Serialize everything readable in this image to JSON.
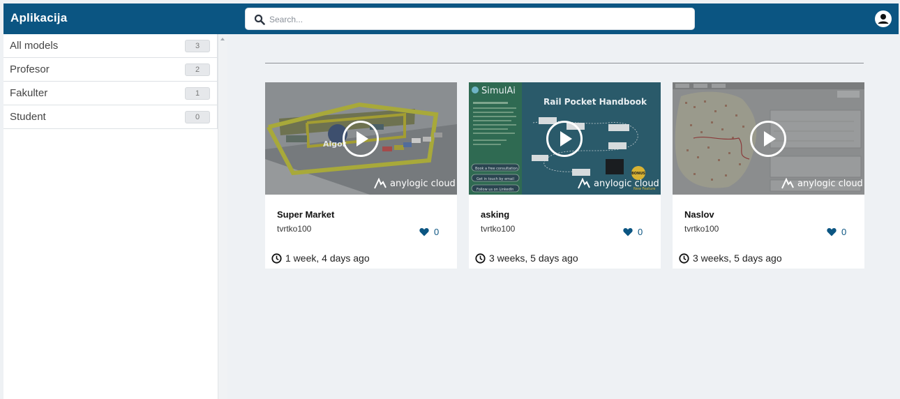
{
  "app": {
    "title": "Aplikacija"
  },
  "search": {
    "placeholder": "Search..."
  },
  "sidebar": {
    "items": [
      {
        "label": "All models",
        "count": "3"
      },
      {
        "label": "Profesor",
        "count": "2"
      },
      {
        "label": "Fakulter",
        "count": "1"
      },
      {
        "label": "Student",
        "count": "0"
      }
    ]
  },
  "models": [
    {
      "title": "Super Market",
      "author": "tvrtko100",
      "likes": "0",
      "time": "1 week, 4 days ago",
      "brand": "anylogic cloud",
      "thumb_text": [
        "Algor"
      ]
    },
    {
      "title": "asking",
      "author": "tvrtko100",
      "likes": "0",
      "time": "3 weeks, 5 days ago",
      "brand": "anylogic cloud",
      "thumb_text": [
        "SimulAi",
        "Rail Pocket Handbook",
        "Book a free consultation",
        "Get in touch by email",
        "Follow us on LinkedIn",
        "BONUS",
        "New Feature"
      ]
    },
    {
      "title": "Naslov",
      "author": "tvrtko100",
      "likes": "0",
      "time": "3 weeks, 5 days ago",
      "brand": "anylogic cloud",
      "thumb_text": []
    }
  ],
  "icons": {
    "search": "search-icon",
    "user": "user-circle-icon",
    "play": "play-icon",
    "heart": "heart-icon",
    "clock": "clock-icon",
    "logo": "anylogic-logo-icon"
  },
  "colors": {
    "topbar": "#0b5582",
    "accent": "#0b5582",
    "background": "#eef1f4"
  }
}
